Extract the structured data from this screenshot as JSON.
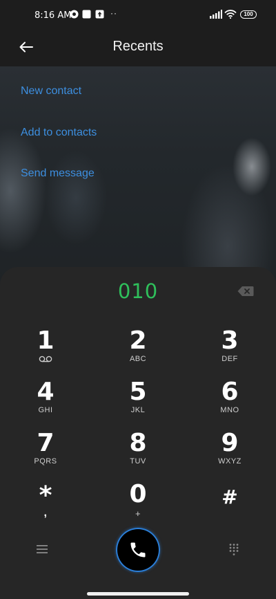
{
  "status": {
    "time": "8:16 AM",
    "dots": "··",
    "battery": "100"
  },
  "header": {
    "title": "Recents"
  },
  "actions": {
    "new_contact": "New contact",
    "add_to_contacts": "Add to contacts",
    "send_message": "Send message"
  },
  "dialer": {
    "number": "010",
    "keys": [
      {
        "digit": "1",
        "letters": ""
      },
      {
        "digit": "2",
        "letters": "ABC"
      },
      {
        "digit": "3",
        "letters": "DEF"
      },
      {
        "digit": "4",
        "letters": "GHI"
      },
      {
        "digit": "5",
        "letters": "JKL"
      },
      {
        "digit": "6",
        "letters": "MNO"
      },
      {
        "digit": "7",
        "letters": "PQRS"
      },
      {
        "digit": "8",
        "letters": "TUV"
      },
      {
        "digit": "9",
        "letters": "WXYZ"
      },
      {
        "digit": "*",
        "letters": ","
      },
      {
        "digit": "0",
        "letters": "+"
      },
      {
        "digit": "#",
        "letters": ""
      }
    ]
  },
  "colors": {
    "accent_blue": "#3d8fe0",
    "number_green": "#2fbf5b",
    "call_ring": "#2c7fd8"
  },
  "icons": {
    "back": "back-arrow-icon",
    "backspace": "backspace-icon",
    "voicemail": "voicemail-icon",
    "menu": "menu-icon",
    "call": "phone-icon",
    "keypad": "keypad-icon"
  }
}
